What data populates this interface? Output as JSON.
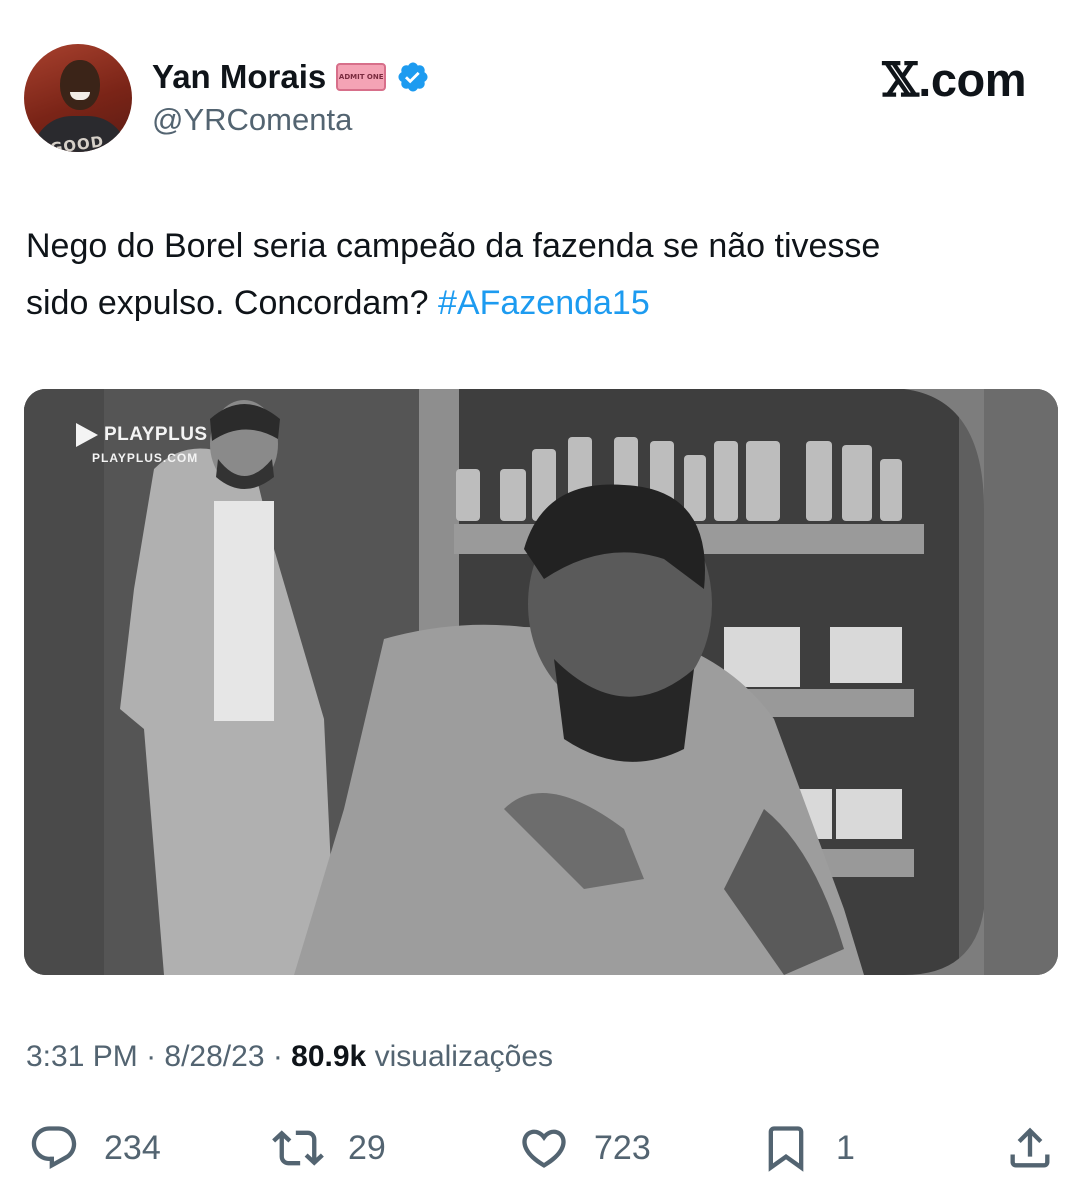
{
  "author": {
    "display_name": "Yan Morais",
    "handle": "@YRComenta",
    "avatar_shirt_text": "GOOD",
    "badge_icon": "ticket-icon",
    "badge_text": "ADMIT ONE",
    "verified_icon": "verified-badge-icon"
  },
  "brand": {
    "x": "𝕏",
    "domain": ".com"
  },
  "tweet": {
    "text_line1": "Nego do Borel seria campeão da fazenda se não tivesse",
    "text_line2": "sido expulso. Concordam?",
    "hashtag": "#AFazenda15"
  },
  "media": {
    "watermark_brand": "PLAYPLUS",
    "watermark_url": "PLAYPLUS.COM"
  },
  "meta": {
    "time": "3:31 PM",
    "date": "8/28/23",
    "views_count": "80.9k",
    "views_label": "visualizações"
  },
  "actions": {
    "replies": "234",
    "reposts": "29",
    "likes": "723",
    "bookmarks": "1"
  },
  "colors": {
    "link": "#1d9bf0",
    "secondary_text": "#536471",
    "text": "#0f1419"
  }
}
